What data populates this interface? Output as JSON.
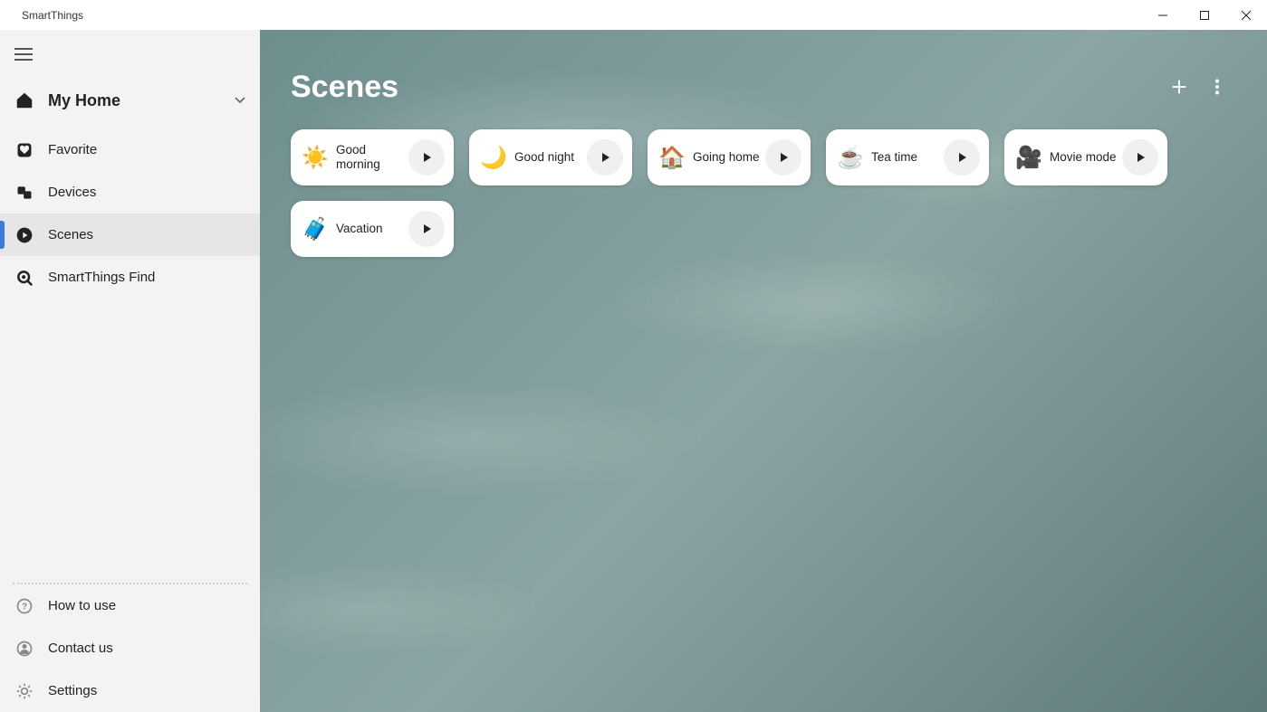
{
  "app_title": "SmartThings",
  "sidebar": {
    "home_label": "My Home",
    "items": [
      {
        "label": "Favorite"
      },
      {
        "label": "Devices"
      },
      {
        "label": "Scenes"
      },
      {
        "label": "SmartThings Find"
      }
    ],
    "footer": [
      {
        "label": "How to use"
      },
      {
        "label": "Contact us"
      },
      {
        "label": "Settings"
      }
    ]
  },
  "page_title": "Scenes",
  "scenes": [
    {
      "label": "Good morning"
    },
    {
      "label": "Good night"
    },
    {
      "label": "Going home"
    },
    {
      "label": "Tea time"
    },
    {
      "label": "Movie mode"
    },
    {
      "label": "Vacation"
    }
  ]
}
